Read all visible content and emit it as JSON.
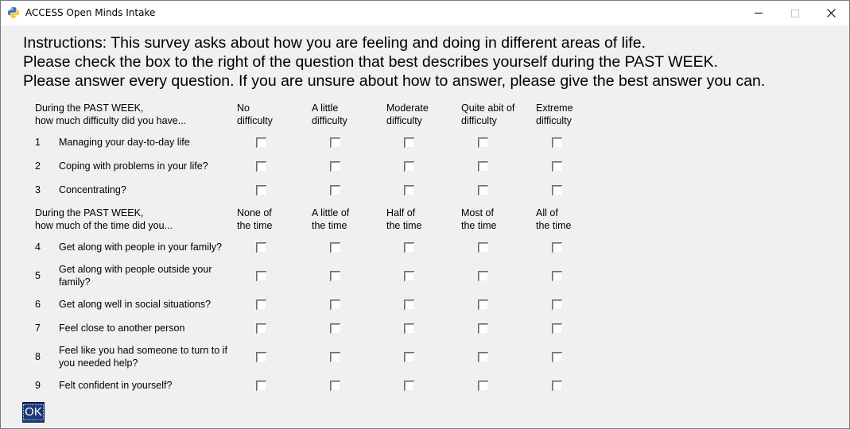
{
  "window": {
    "title": "ACCESS Open Minds Intake",
    "close_glyph": "✕"
  },
  "instructions": [
    "Instructions: This survey asks about how you are feeling and doing in different areas of life.",
    "Please check the box to the right of the question that best describes yourself during the PAST WEEK.",
    "Please answer every question. If you are unsure about how to answer, please give the best answer you can."
  ],
  "sections": [
    {
      "prompt": [
        "During the PAST WEEK,",
        "how much difficulty did you have..."
      ],
      "options": [
        [
          "No",
          "difficulty"
        ],
        [
          "A little",
          "difficulty"
        ],
        [
          "Moderate",
          "difficulty"
        ],
        [
          "Quite abit of",
          "difficulty"
        ],
        [
          "Extreme",
          "difficulty"
        ]
      ],
      "questions": [
        {
          "num": "1",
          "text": [
            "Managing your day-to-day life"
          ]
        },
        {
          "num": "2",
          "text": [
            "Coping with problems in your life?"
          ]
        },
        {
          "num": "3",
          "text": [
            "Concentrating?"
          ]
        }
      ]
    },
    {
      "prompt": [
        "During the PAST WEEK,",
        "how much of the time did you..."
      ],
      "options": [
        [
          "None of",
          "the time"
        ],
        [
          "A little of",
          "the time"
        ],
        [
          "Half of",
          "the time"
        ],
        [
          "Most of",
          "the time"
        ],
        [
          "All of",
          "the time"
        ]
      ],
      "questions": [
        {
          "num": "4",
          "text": [
            "Get along with people in your family?"
          ]
        },
        {
          "num": "5",
          "text": [
            "Get along with people outside your",
            "family?"
          ]
        },
        {
          "num": "6",
          "text": [
            "Get along well in social situations?"
          ]
        },
        {
          "num": "7",
          "text": [
            "Feel close to another person"
          ]
        },
        {
          "num": "8",
          "text": [
            "Feel like you had someone to turn to if",
            "you needed help?"
          ]
        },
        {
          "num": "9",
          "text": [
            "Felt confident in yourself?"
          ]
        }
      ]
    }
  ],
  "ok_label": "OK"
}
